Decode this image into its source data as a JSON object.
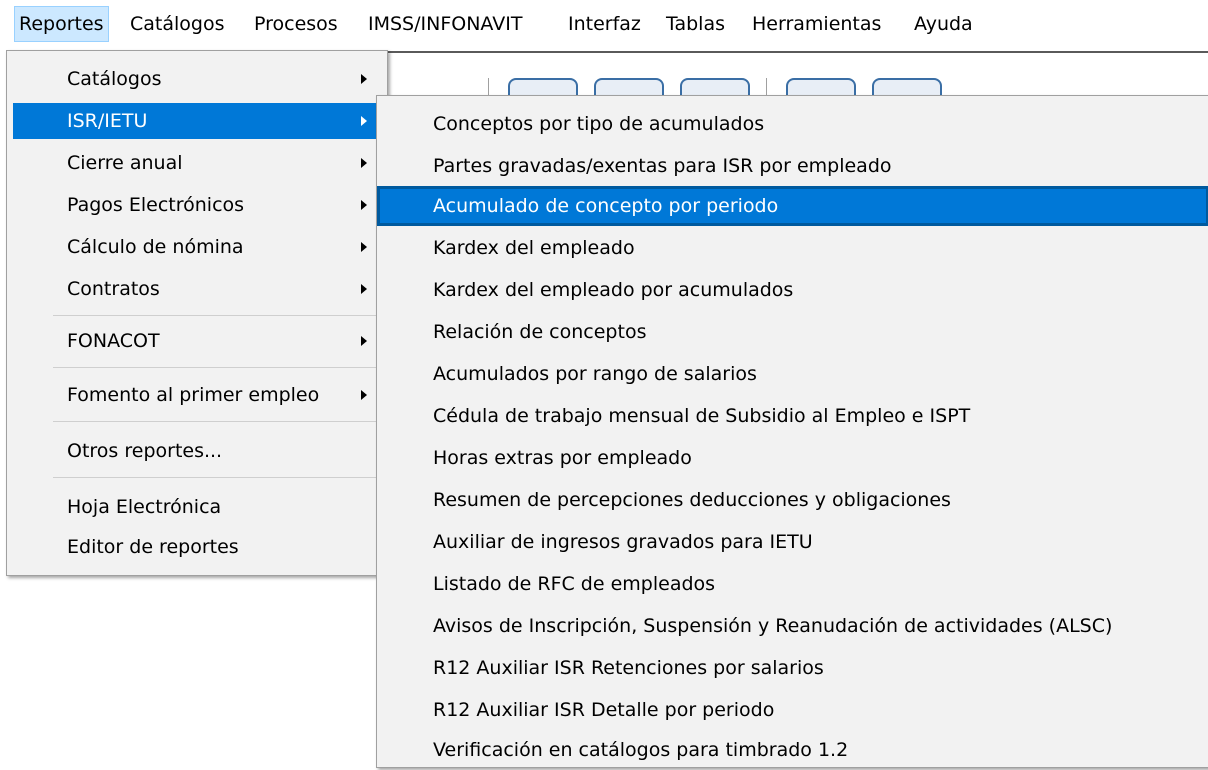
{
  "menubar": {
    "items": [
      {
        "label": "Reportes"
      },
      {
        "label": "Catálogos"
      },
      {
        "label": "Procesos"
      },
      {
        "label": "IMSS/INFONAVIT"
      },
      {
        "label": "Interfaz"
      },
      {
        "label": "Tablas"
      },
      {
        "label": "Herramientas"
      },
      {
        "label": "Ayuda"
      }
    ]
  },
  "reportes_menu": {
    "items": [
      {
        "label": "Catálogos",
        "has_submenu": true
      },
      {
        "label": "ISR/IETU",
        "has_submenu": true,
        "selected": true
      },
      {
        "label": "Cierre anual",
        "has_submenu": true
      },
      {
        "label": "Pagos Electrónicos",
        "has_submenu": true
      },
      {
        "label": "Cálculo de nómina",
        "has_submenu": true
      },
      {
        "label": "Contratos",
        "has_submenu": true
      },
      {
        "label": "FONACOT",
        "has_submenu": true
      },
      {
        "label": "Fomento al primer empleo",
        "has_submenu": true
      },
      {
        "label": "Otros reportes..."
      },
      {
        "label": "Hoja Electrónica"
      },
      {
        "label": "Editor de reportes"
      }
    ]
  },
  "isr_ietu_submenu": {
    "items": [
      {
        "label": "Conceptos por tipo de acumulados"
      },
      {
        "label": "Partes gravadas/exentas para ISR por empleado"
      },
      {
        "label": "Acumulado de concepto por periodo",
        "selected": true
      },
      {
        "label": "Kardex del empleado"
      },
      {
        "label": "Kardex del empleado por acumulados"
      },
      {
        "label": "Relación de conceptos"
      },
      {
        "label": "Acumulados por rango de salarios"
      },
      {
        "label": "Cédula de trabajo mensual de Subsidio al Empleo e ISPT"
      },
      {
        "label": "Horas extras por empleado"
      },
      {
        "label": "Resumen de percepciones deducciones y obligaciones"
      },
      {
        "label": "Auxiliar de ingresos gravados para IETU"
      },
      {
        "label": "Listado de RFC de empleados"
      },
      {
        "label": "Avisos de Inscripción, Suspensión y Reanudación de actividades (ALSC)"
      },
      {
        "label": "R12 Auxiliar ISR Retenciones por salarios"
      },
      {
        "label": "R12 Auxiliar ISR Detalle por periodo"
      },
      {
        "label": "Verificación en catálogos para timbrado 1.2"
      }
    ]
  },
  "colors": {
    "selection": "#0078d7",
    "menu_bg": "#f2f2f2",
    "menubar_active": "#cce8ff"
  }
}
